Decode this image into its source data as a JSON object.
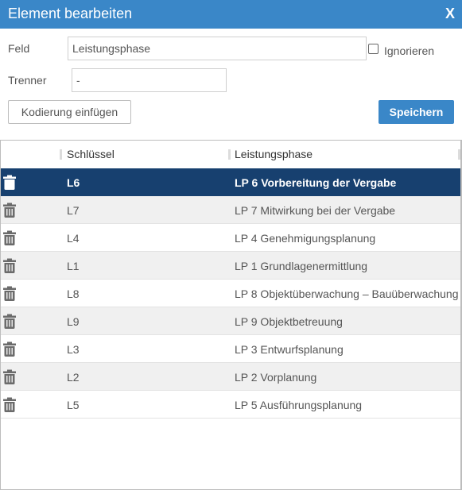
{
  "dialog": {
    "title": "Element bearbeiten",
    "close_label": "X"
  },
  "form": {
    "feld_label": "Feld",
    "feld_value": "Leistungsphase",
    "ignorieren_label": "Ignorieren",
    "ignorieren_checked": false,
    "trenner_label": "Trenner",
    "trenner_value": "-"
  },
  "buttons": {
    "insert_label": "Kodierung einfügen",
    "save_label": "Speichern"
  },
  "table": {
    "columns": [
      "Schlüssel",
      "Leistungsphase"
    ],
    "selected_index": 0,
    "rows": [
      {
        "key": "L6",
        "phase": "LP 6 Vorbereitung der Vergabe"
      },
      {
        "key": "L7",
        "phase": "LP 7 Mitwirkung bei der Vergabe"
      },
      {
        "key": "L4",
        "phase": "LP 4 Genehmigungsplanung"
      },
      {
        "key": "L1",
        "phase": "LP 1 Grundlagenermittlung"
      },
      {
        "key": "L8",
        "phase": "LP 8 Objektüberwachung – Bauüberwachung"
      },
      {
        "key": "L9",
        "phase": "LP 9 Objektbetreuung"
      },
      {
        "key": "L3",
        "phase": "LP 3 Entwurfsplanung"
      },
      {
        "key": "L2",
        "phase": "LP 2 Vorplanung"
      },
      {
        "key": "L5",
        "phase": "LP 5 Ausführungsplanung"
      }
    ]
  },
  "colors": {
    "accent": "#3a87c8",
    "selected_row": "#17406f",
    "icon": "#6b6b6b"
  },
  "icons": {
    "close": "close-icon",
    "row_action": "trash-icon"
  }
}
